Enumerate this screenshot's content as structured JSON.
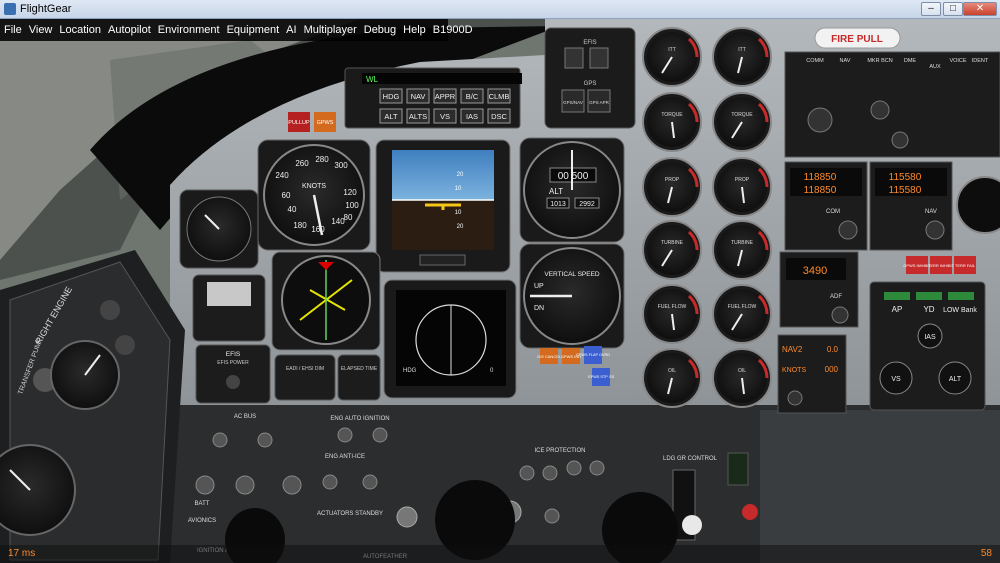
{
  "window": {
    "title": "FlightGear",
    "min_label": "–",
    "max_label": "□",
    "close_label": "✕"
  },
  "menu": [
    "File",
    "View",
    "Location",
    "Autopilot",
    "Environment",
    "Equipment",
    "AI",
    "Multiplayer",
    "Debug",
    "Help",
    "B1900D"
  ],
  "status": {
    "frame_time": "17 ms",
    "fps": "58"
  },
  "panel": {
    "fire_pull": "FIRE PULL",
    "efis": "EFIS",
    "gps": "GPS",
    "gps_left": "GPS/NAV",
    "gps_right": "GPS APR",
    "mode_display": "WL",
    "ap_row1": [
      "HDG",
      "NAV",
      "APPR",
      "B/C",
      "CLMB"
    ],
    "ap_row2": [
      "ALT",
      "ALTS",
      "VS",
      "IAS",
      "DSC"
    ],
    "pullup": "PULLUP",
    "gpws": "GPWS",
    "asi": {
      "label": "KNOTS",
      "ticks": [
        "260",
        "280",
        "300",
        "240",
        "120",
        "100",
        "80",
        "60",
        "40",
        "180",
        "160",
        "140"
      ]
    },
    "altimeter": {
      "label": "ALT",
      "readout": "00 500",
      "baro_left": "1013",
      "baro_right": "2992"
    },
    "vsi": {
      "label": "VERTICAL SPEED",
      "up": "UP",
      "dn": "DN"
    },
    "adi_scale": [
      "20",
      "10",
      "10",
      "20"
    ],
    "hsi_left": "HDG",
    "hsi_dist": "0",
    "efis_label": "EFIS",
    "efis_power": "EFIS POWER",
    "eadi": "EADI / EHSI DIM",
    "elapsed": "ELAPSED TIME",
    "gs_cancel": "G/S CANCEL",
    "gpws_inh": "GPWS INH",
    "gpws_flp": "GPWS FLAP OVRD",
    "gps_gs": "GPWS STP GS",
    "engine_gauges": [
      "ITT",
      "ITT",
      "TORQUE",
      "TORQUE",
      "PROP",
      "PROP",
      "TURBINE",
      "TURBINE",
      "FUEL FLOW",
      "FUEL FLOW",
      "OIL",
      "OIL"
    ],
    "comm_labels": [
      "COMM",
      "NAV",
      "MKR BCN",
      "DME",
      "AUX",
      "VOICE",
      "IDENT"
    ],
    "comm1_active": "118850",
    "comm1_standby": "118850",
    "nav1_active": "115580",
    "nav1_standby": "115580",
    "adf_readout": "3490",
    "adf_label": "ADF",
    "com_label": "COM",
    "nav_label": "NAV",
    "terr_inhibit": "TERR INHIBIT",
    "terr_fail": "TERR FAIL",
    "gpws_inhibit": "GPWS INHIBIT",
    "nav2": "NAV2",
    "nav2_val": "0.0",
    "knots_lbl": "KNOTS",
    "knots_val": "000",
    "ap_panel": [
      "AP",
      "YD",
      "LOW Bank"
    ],
    "ap_buttons": [
      "IAS",
      "VS",
      "ALT"
    ],
    "right_engine": "RIGHT ENGINE",
    "transfer": "TRANSFER PUMP",
    "ac_bus": "AC BUS",
    "eng_auto_ign": "ENG AUTO IGNITION",
    "eng_anti_ice": "ENG ANTI-ICE",
    "ice_protection": "ICE PROTECTION",
    "ldg_gr": "LDG GR CONTROL",
    "batt": "BATT",
    "avionics": "AVIONICS",
    "actuators": "ACTUATORS STANDBY",
    "ign_start": "IGNITION AND ENGINE START",
    "autofeather": "AUTOFEATHER"
  },
  "colors": {
    "panel_bg": "#9fa5a9",
    "gauge_bg": "#121212",
    "needle": "#e8e8e8",
    "accent_red": "#c62a2a",
    "amber": "#ff8a2a"
  }
}
